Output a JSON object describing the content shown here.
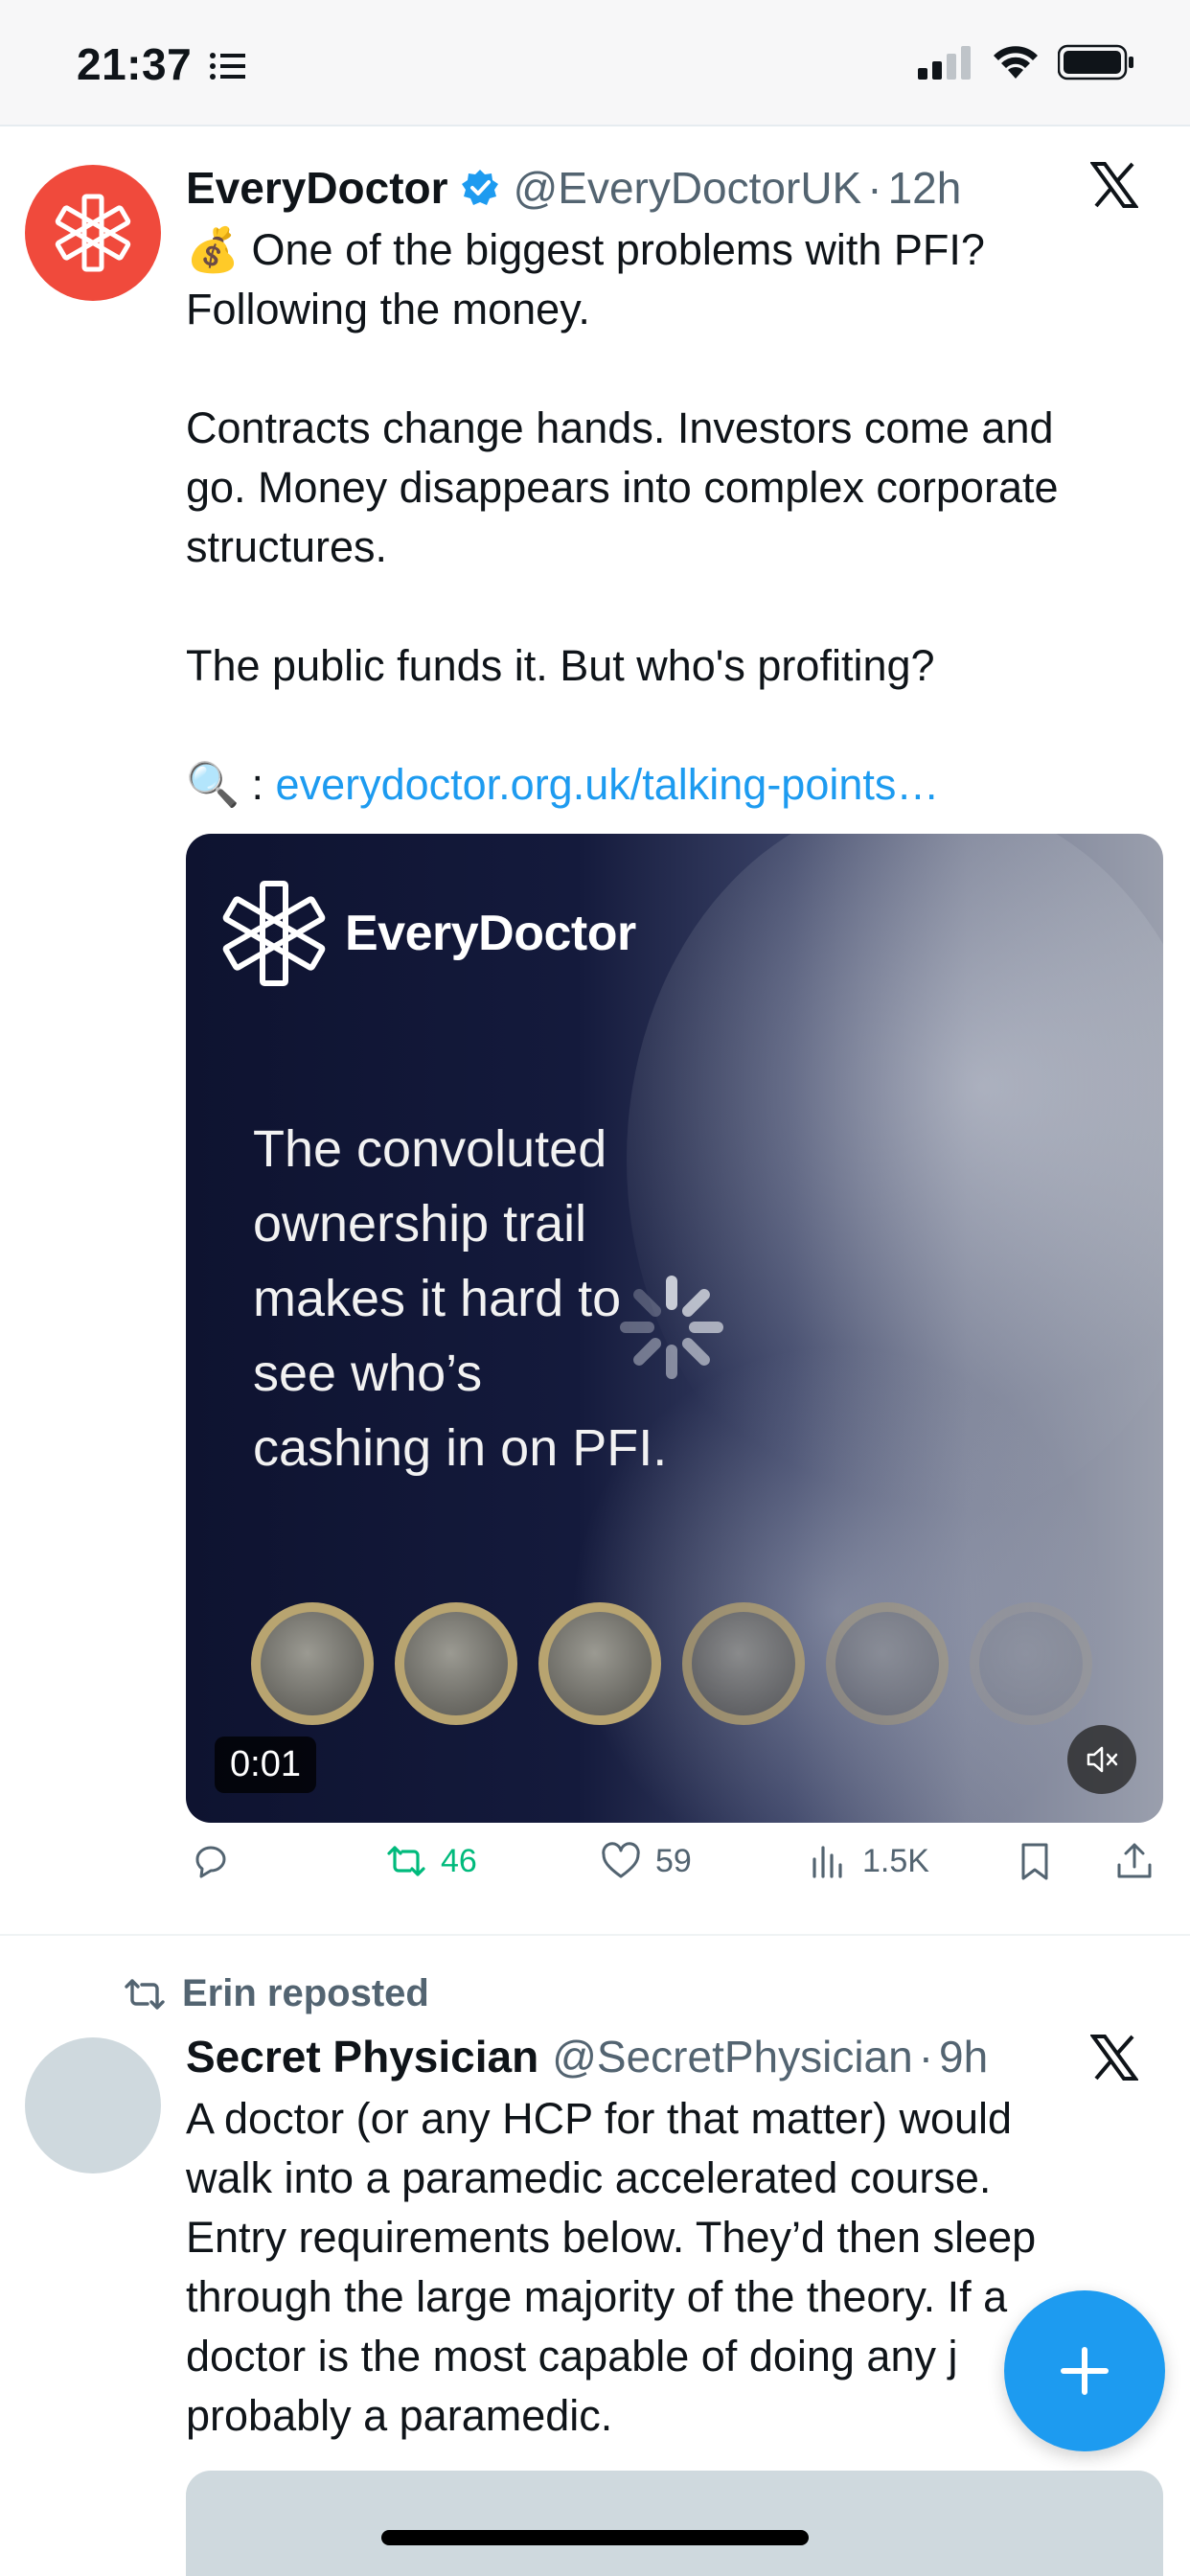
{
  "status_bar": {
    "time": "21:37"
  },
  "tweets": [
    {
      "author_name": "EveryDoctor",
      "verified": true,
      "handle": "@EveryDoctorUK",
      "separator": "·",
      "timestamp": "12h",
      "text_line1": "💰 One of the biggest problems with PFI?\nFollowing the money.",
      "text_line2": "Contracts change hands. Investors come and\ngo. Money disappears into complex corporate\nstructures.",
      "text_line3": "The public funds it. But who's profiting?",
      "link_prefix": "🔍 : ",
      "link_text": "everydoctor.org.uk/talking-points…",
      "media": {
        "brand": "EveryDoctor",
        "overlay_text": "The convoluted\nownership trail\nmakes it hard to\nsee who’s\ncashing in on PFI.",
        "duration": "0:01"
      },
      "stats": {
        "retweets": "46",
        "likes": "59",
        "views": "1.5K"
      }
    },
    {
      "repost_label": "Erin reposted",
      "author_name": "Secret Physician",
      "handle": "@SecretPhysician",
      "separator": "·",
      "timestamp": "9h",
      "text": "A doctor (or any HCP for that matter) would\nwalk into a paramedic accelerated course.\nEntry requirements below. They’d then sleep\nthrough the large majority of the theory. If a\ndoctor is the most capable of doing any j\nprobably a paramedic."
    }
  ],
  "fab": {
    "icon": "plus-icon"
  },
  "colors": {
    "accent": "#1d9bf0",
    "retweet_green": "#00ba7c",
    "brand_red": "#f04a3c"
  }
}
